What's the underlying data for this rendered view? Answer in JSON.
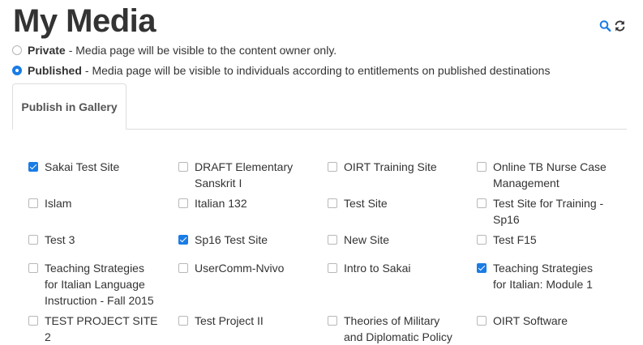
{
  "page": {
    "title": "My Media"
  },
  "toolbar": {
    "search_icon": "search-icon",
    "refresh_icon": "refresh-icon"
  },
  "privacy": {
    "private_label": "Private",
    "private_desc": "- Media page will be visible to the content owner only.",
    "private_checked": false,
    "published_label": "Published",
    "published_desc": "- Media page will be visible to individuals according to entitlements on published destinations",
    "published_checked": true
  },
  "tabs": [
    {
      "label": "Publish in Gallery",
      "active": true
    }
  ],
  "sites": [
    {
      "label": "Sakai Test Site",
      "checked": true
    },
    {
      "label": "DRAFT Elementary Sanskrit I",
      "checked": false
    },
    {
      "label": "OIRT Training Site",
      "checked": false
    },
    {
      "label": "Online TB Nurse Case Management",
      "checked": false
    },
    {
      "label": "Islam",
      "checked": false
    },
    {
      "label": "Italian 132",
      "checked": false
    },
    {
      "label": "Test Site",
      "checked": false
    },
    {
      "label": "Test Site for Training - Sp16",
      "checked": false
    },
    {
      "label": "Test 3",
      "checked": false
    },
    {
      "label": "Sp16 Test Site",
      "checked": true
    },
    {
      "label": "New Site",
      "checked": false
    },
    {
      "label": "Test F15",
      "checked": false
    },
    {
      "label": "Teaching Strategies for Italian Language Instruction - Fall 2015",
      "checked": false
    },
    {
      "label": "UserComm-Nvivo",
      "checked": false
    },
    {
      "label": "Intro to Sakai",
      "checked": false
    },
    {
      "label": "Teaching Strategies for Italian: Module 1",
      "checked": true
    },
    {
      "label": "TEST PROJECT SITE 2",
      "checked": false
    },
    {
      "label": "Test Project II",
      "checked": false
    },
    {
      "label": "Theories of Military and Diplomatic Policy",
      "checked": false
    },
    {
      "label": "OIRT Software",
      "checked": false
    }
  ],
  "colors": {
    "accent": "#1a7ce5",
    "text": "#333333"
  }
}
